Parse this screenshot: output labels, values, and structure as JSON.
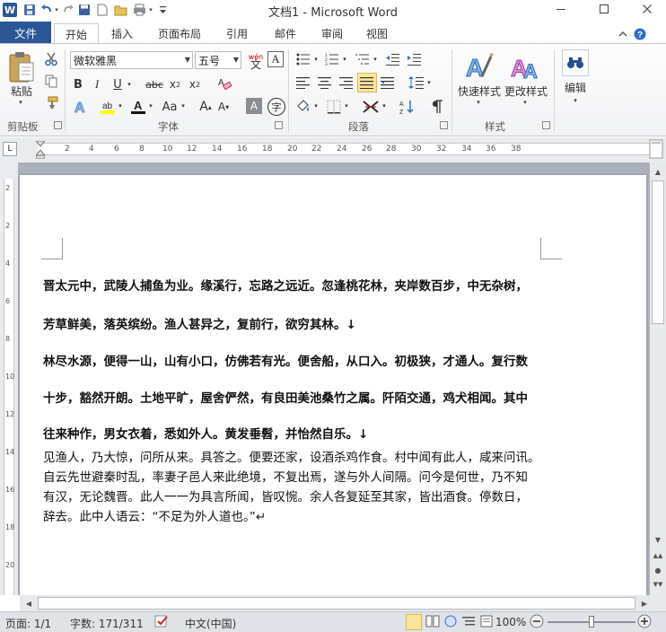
{
  "window": {
    "title": "文档1 - Microsoft Word",
    "app_icon": "W",
    "controls": [
      "minimize",
      "maximize",
      "close"
    ]
  },
  "quick_access": [
    "save-icon",
    "undo-icon",
    "redo-icon",
    "new-icon",
    "open-icon",
    "print-icon",
    "customize-icon"
  ],
  "tabs": [
    "文件",
    "开始",
    "插入",
    "页面布局",
    "引用",
    "邮件",
    "审阅",
    "视图"
  ],
  "active_tab": "开始",
  "ribbon": {
    "clipboard": {
      "label": "剪贴板",
      "paste": "粘贴"
    },
    "font": {
      "label": "字体",
      "font_name": "微软雅黑",
      "font_size": "五号",
      "wen": "wén",
      "big_a": "A",
      "change_case": "Aa",
      "grow": "A",
      "shrink": "A",
      "char_border": "A",
      "enclose": "字"
    },
    "paragraph": {
      "label": "段落"
    },
    "styles": {
      "label": "样式",
      "quick": "快速样式",
      "change": "更改样式"
    },
    "editing": {
      "label": "编辑"
    }
  },
  "ruler": {
    "numbers": [
      "2",
      "4",
      "6",
      "8",
      "10",
      "12",
      "14",
      "16",
      "18",
      "20",
      "22",
      "24",
      "26",
      "28",
      "30",
      "32",
      "34",
      "36",
      "38"
    ]
  },
  "vruler": {
    "numbers": [
      "2",
      "2",
      "4",
      "6",
      "8",
      "10",
      "12",
      "14",
      "16",
      "18",
      "20"
    ]
  },
  "document": {
    "bold_lines": [
      "晋太元中，武陵人捕鱼为业。缘溪行，忘路之远近。忽逢桃花林，夹岸数百步，中无杂树，",
      "芳草鲜美，落英缤纷。渔人甚异之，复前行，欲穷其林。↓",
      "林尽水源，便得一山，山有小口，仿佛若有光。便舍船，从口入。初极狭，才通人。复行数",
      "十步，豁然开朗。土地平旷，屋舍俨然，有良田美池桑竹之属。阡陌交通，鸡犬相闻。其中",
      "往来种作，男女衣着，悉如外人。黄发垂髫，并怡然自乐。↓"
    ],
    "normal_lines": [
      "见渔人，乃大惊，问所从来。具答之。便要还家，设酒杀鸡作食。村中闻有此人，咸来问讯。",
      "自云先世避秦时乱，率妻子邑人来此绝境，不复出焉，遂与外人间隔。问今是何世，乃不知",
      "有汉，无论魏晋。此人一一为具言所闻，皆叹惋。余人各复延至其家，皆出酒食。停数日，",
      "辞去。此中人语云：“不足为外人道也。”↵"
    ]
  },
  "status": {
    "page": "页面: 1/1",
    "words": "字数: 171/311",
    "language": "中文(中国)",
    "zoom": "100%",
    "zoom_level_percent": 100
  },
  "colors": {
    "file_tab": "#2b5797",
    "ribbon_bg": "#f1f2f4",
    "doc_bg": "#abb1bb"
  }
}
